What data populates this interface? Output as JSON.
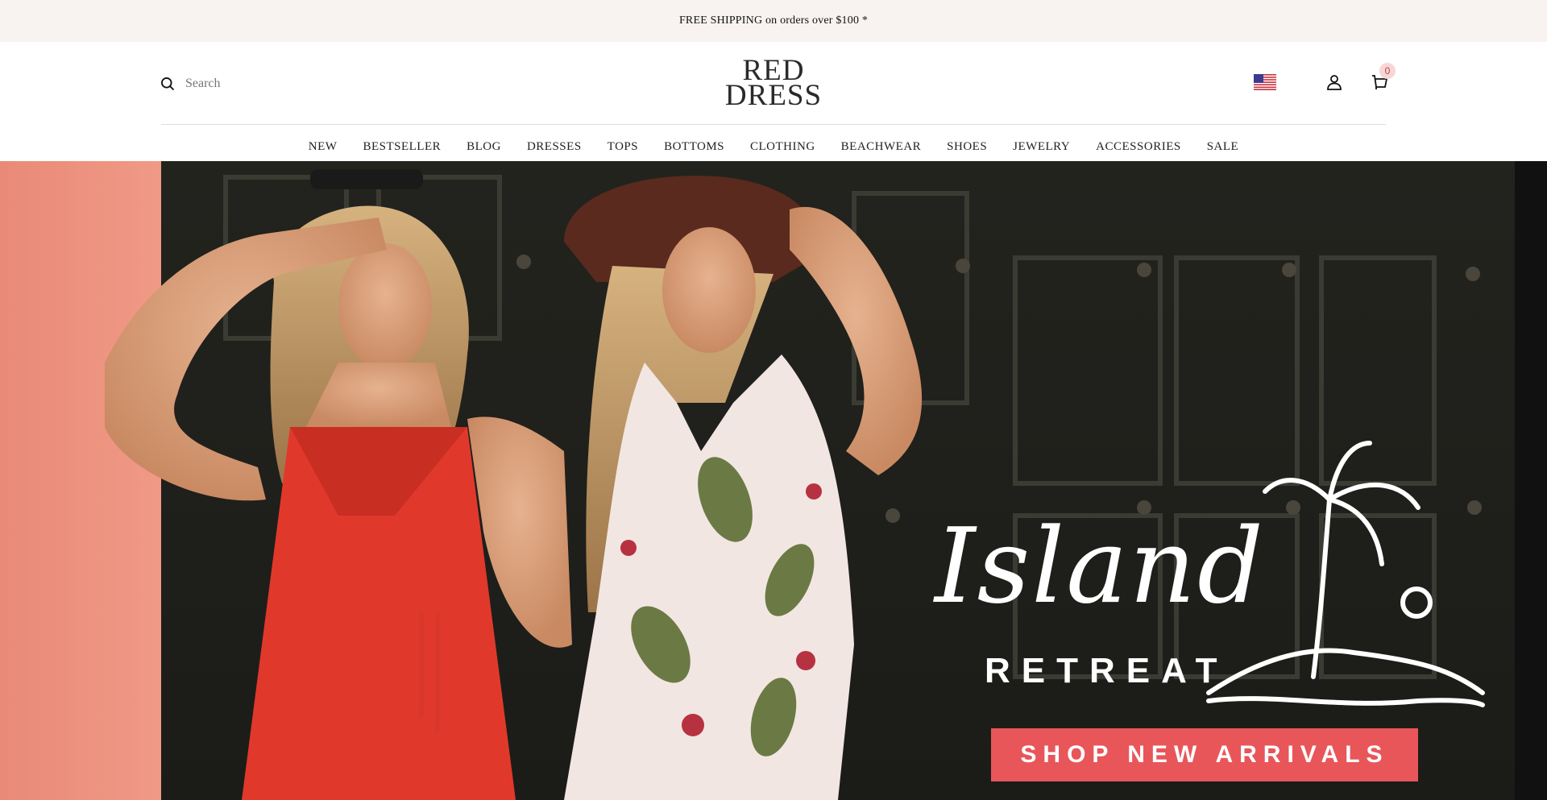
{
  "announcement": {
    "text": "FREE SHIPPING on orders over $100 *"
  },
  "header": {
    "search_placeholder": "Search",
    "logo_line1": "RED",
    "logo_line2": "DRESS",
    "cart_count": "0",
    "region_flag": "us-flag-icon"
  },
  "nav": {
    "items": [
      {
        "label": "NEW"
      },
      {
        "label": "BESTSELLER"
      },
      {
        "label": "BLOG"
      },
      {
        "label": "DRESSES"
      },
      {
        "label": "TOPS"
      },
      {
        "label": "BOTTOMS"
      },
      {
        "label": "CLOTHING"
      },
      {
        "label": "BEACHWEAR"
      },
      {
        "label": "SHOES"
      },
      {
        "label": "JEWELRY"
      },
      {
        "label": "ACCESSORIES"
      },
      {
        "label": "SALE"
      }
    ]
  },
  "hero": {
    "headline": "Island",
    "subheadline": "RETREAT",
    "cta_label": "SHOP NEW ARRIVALS",
    "cta_color": "#e8565a"
  },
  "colors": {
    "announcement_bg": "#f8f3f0",
    "text": "#222222",
    "cart_badge_bg": "#f6d6d6"
  }
}
